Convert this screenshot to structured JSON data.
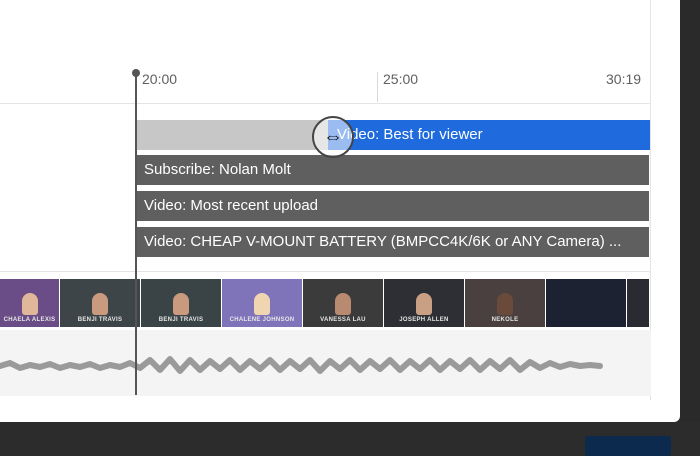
{
  "ruler": {
    "t1": "20:00",
    "t2": "25:00",
    "t3": "30:19"
  },
  "end_screen": {
    "elements": [
      {
        "label": "Video: Best for viewer",
        "state": "selected"
      },
      {
        "label": "Subscribe: Nolan Molt"
      },
      {
        "label": "Video: Most recent upload"
      },
      {
        "label": "Video: CHEAP V-MOUNT BATTERY (BMPCC4K/6K or ANY Camera) ..."
      }
    ]
  },
  "thumbnails": [
    {
      "caption": "CHAELA ALEXIS"
    },
    {
      "caption": "BENJI TRAVIS"
    },
    {
      "caption": "BENJI TRAVIS"
    },
    {
      "caption": "CHALENE JOHNSON"
    },
    {
      "caption": "VANESSA LAU"
    },
    {
      "caption": "JOSEPH ALLEN"
    },
    {
      "caption": "NEKOLE"
    },
    {
      "caption": ""
    },
    {
      "caption": ""
    }
  ],
  "icons": {
    "resize_handle": "resize-horizontal-icon"
  },
  "colors": {
    "selected_element": "#1f6bde",
    "element_bar": "#5f5f5f",
    "playhead": "#555555"
  }
}
